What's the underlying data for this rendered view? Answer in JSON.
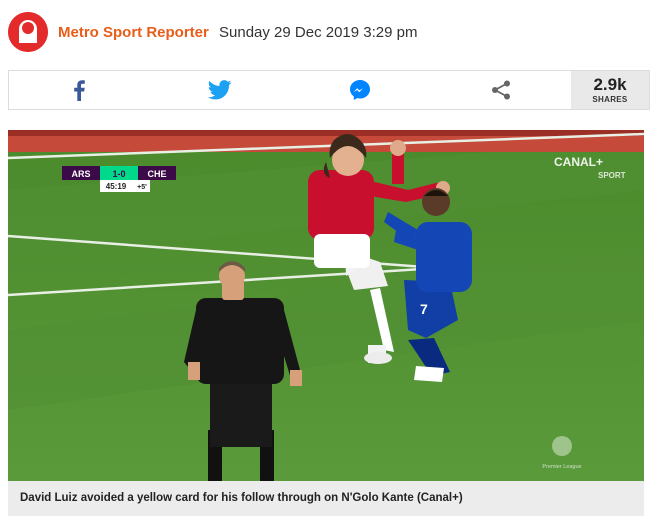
{
  "article": {
    "author": "Metro Sport Reporter",
    "datetime": "Sunday 29 Dec 2019 3:29 pm"
  },
  "share": {
    "buttons": [
      {
        "name": "facebook",
        "icon": "facebook-icon",
        "color": "#3b5998"
      },
      {
        "name": "twitter",
        "icon": "twitter-icon",
        "color": "#1da1f2"
      },
      {
        "name": "messenger",
        "icon": "messenger-icon",
        "color": "#0084ff"
      },
      {
        "name": "share",
        "icon": "share-icon",
        "color": "#555555"
      }
    ],
    "count": "2.9k",
    "count_label": "SHARES"
  },
  "image": {
    "scoreboard": {
      "home": "ARS",
      "score": "1-0",
      "away": "CHE",
      "clock": "45:19",
      "added": "+5'"
    },
    "broadcaster": "CANAL+",
    "broadcaster_sub": "SPORT",
    "league_logo": "Premier League",
    "caption": "David Luiz avoided a yellow card for his follow through on N'Golo Kante (Canal+)"
  },
  "colors": {
    "brand": "#e32b2b",
    "author": "#e85d1a",
    "pitch": "#4f8a2f"
  }
}
